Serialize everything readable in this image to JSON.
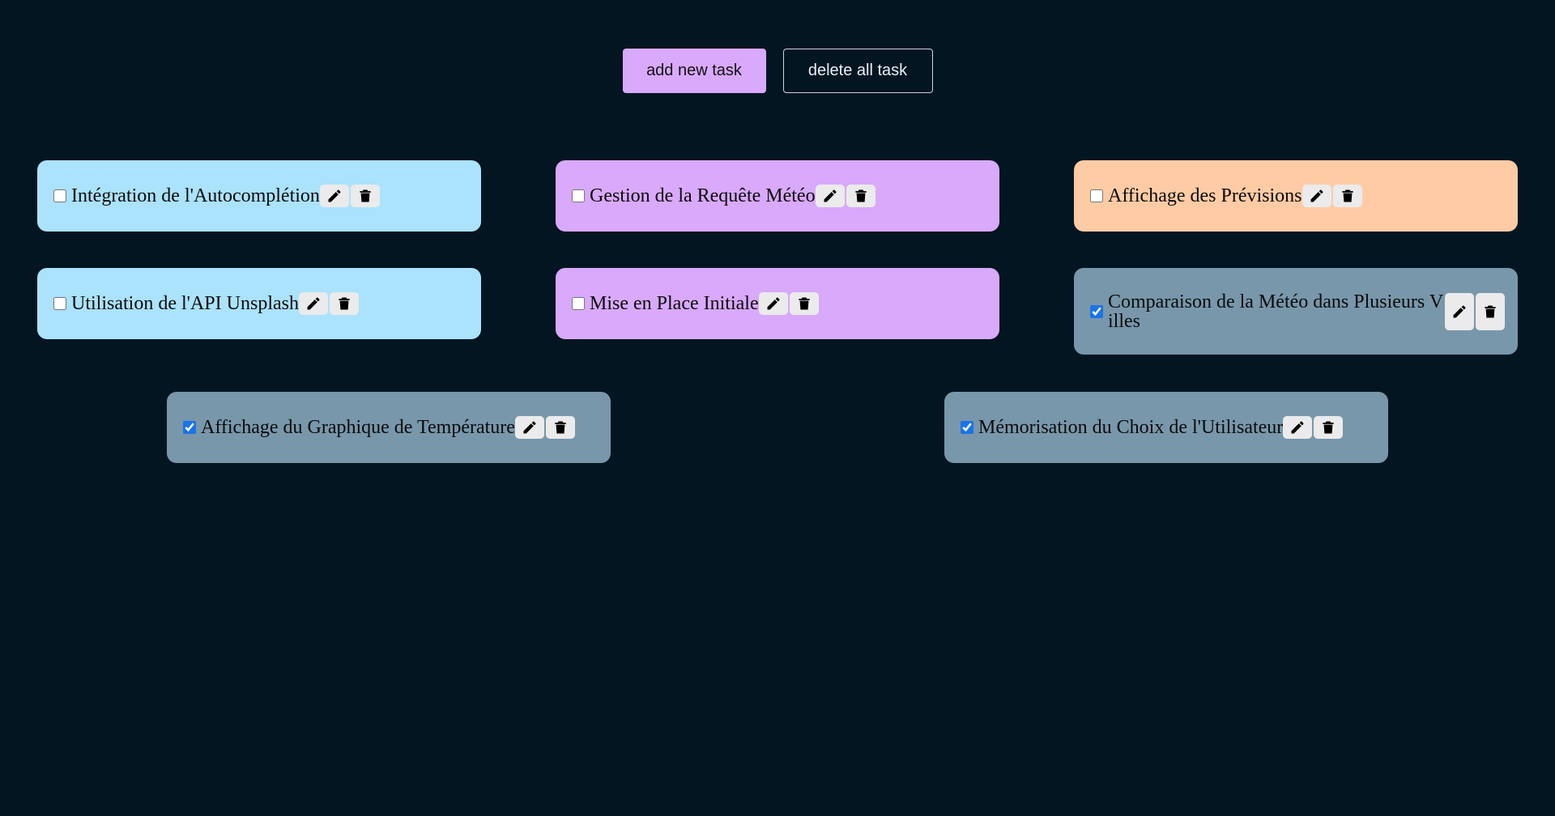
{
  "toolbar": {
    "add_label": "add new task",
    "delete_all_label": "delete all task"
  },
  "colors": {
    "background": "#031521",
    "light_blue": "#abe2fc",
    "lavender": "#d9a9fb",
    "peach": "#fecba5",
    "done_gray": "#7897ab"
  },
  "tasks": [
    {
      "title": "Intégration de l'Autocomplétion",
      "checked": false,
      "color": "light_blue"
    },
    {
      "title": "Gestion de la Requête Météo",
      "checked": false,
      "color": "lavender"
    },
    {
      "title": "Affichage des Prévisions",
      "checked": false,
      "color": "peach"
    },
    {
      "title": "Utilisation de l'API Unsplash",
      "checked": false,
      "color": "light_blue"
    },
    {
      "title": "Mise en Place Initiale",
      "checked": false,
      "color": "lavender"
    },
    {
      "title": "Comparaison de la Météo dans Plusieurs Villes",
      "checked": true,
      "color": "done_gray"
    },
    {
      "title": "Affichage du Graphique de Température",
      "checked": true,
      "color": "done_gray"
    },
    {
      "title": "Mémorisation du Choix de l'Utilisateur",
      "checked": true,
      "color": "done_gray"
    }
  ],
  "icons": {
    "edit": "pencil-icon",
    "delete": "trash-icon"
  }
}
